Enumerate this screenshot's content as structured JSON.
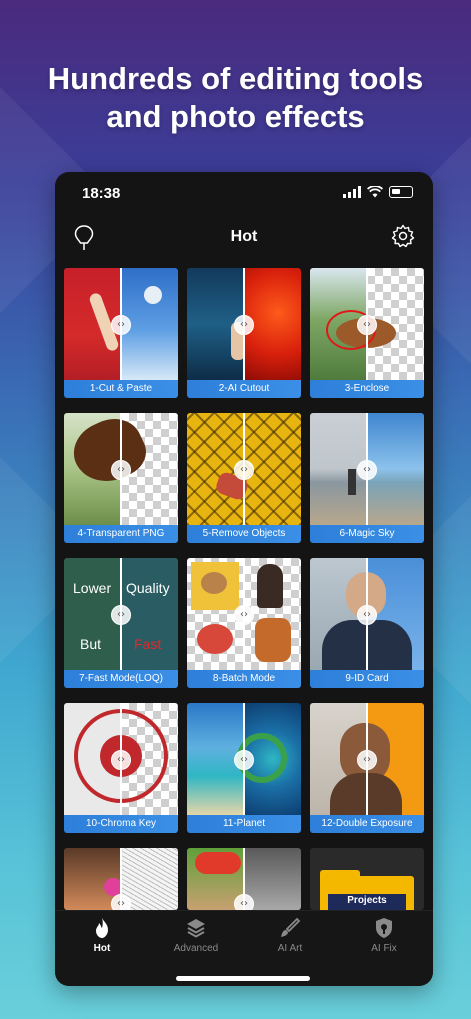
{
  "headline": {
    "line1": "Hundreds of editing tools",
    "line2": "and photo effects"
  },
  "status_bar": {
    "time": "18:38",
    "icons": [
      "signal-icon",
      "wifi-icon",
      "battery-icon"
    ]
  },
  "nav": {
    "title": "Hot",
    "left_icon": "lightbulb-icon",
    "right_icon": "gear-icon"
  },
  "tools": [
    {
      "label": "1-Cut & Paste"
    },
    {
      "label": "2-AI Cutout"
    },
    {
      "label": "3-Enclose"
    },
    {
      "label": "4-Transparent PNG"
    },
    {
      "label": "5-Remove Objects"
    },
    {
      "label": "6-Magic Sky"
    },
    {
      "label": "7-Fast Mode(LOQ)",
      "overlay": {
        "tl": "Lower",
        "tr": "Quality",
        "bl": "But",
        "br": "Fast"
      }
    },
    {
      "label": "8-Batch Mode"
    },
    {
      "label": "9-ID Card"
    },
    {
      "label": "10-Chroma Key"
    },
    {
      "label": "11-Planet"
    },
    {
      "label": "12-Double Exposure"
    },
    {
      "label": ""
    },
    {
      "label": ""
    },
    {
      "label": "",
      "folder_text": "Projects"
    }
  ],
  "compare_handle_glyph": "‹›",
  "tabbar": {
    "items": [
      {
        "label": "Hot",
        "icon": "flame-icon",
        "active": true
      },
      {
        "label": "Advanced",
        "icon": "layers-icon",
        "active": false
      },
      {
        "label": "AI Art",
        "icon": "brush-icon",
        "active": false
      },
      {
        "label": "AI Fix",
        "icon": "shield-icon",
        "active": false
      }
    ]
  },
  "colors": {
    "label_blue": "#2d7fd9",
    "phone_bg": "#141414",
    "folder_yellow": "#f5b800",
    "folder_navy": "#1e2a5a"
  }
}
